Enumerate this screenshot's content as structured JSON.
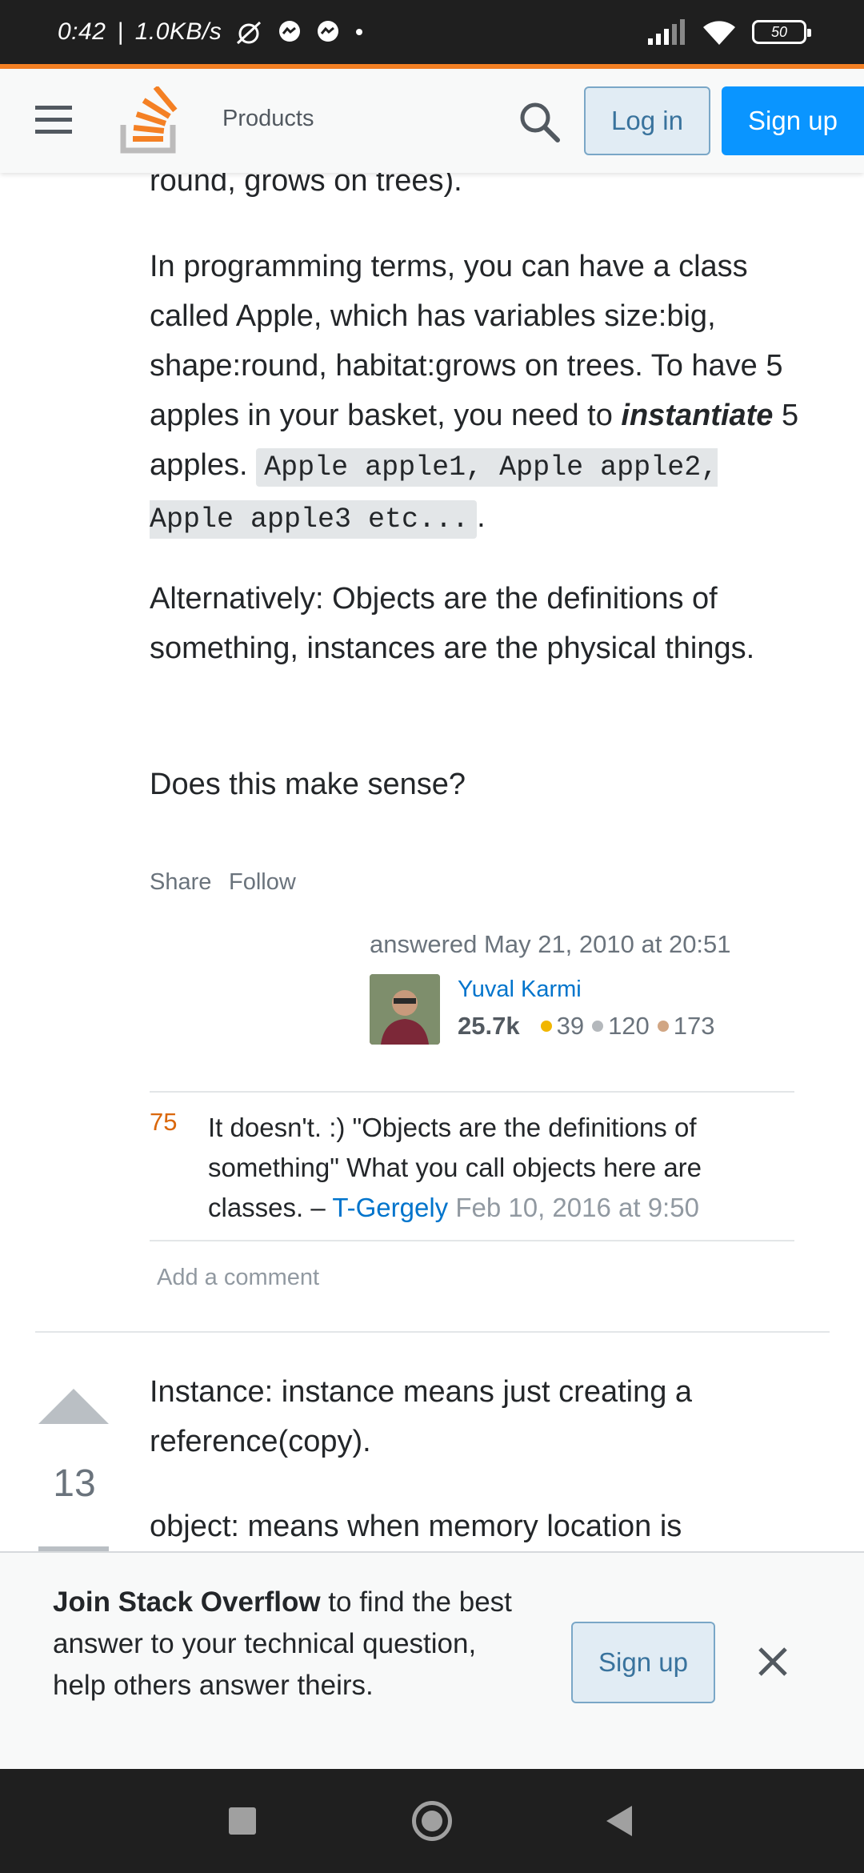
{
  "status_bar": {
    "time": "0:42",
    "separator": "|",
    "network_speed": "1.0KB/s",
    "battery": "50"
  },
  "header": {
    "products_label": "Products",
    "login_label": "Log in",
    "signup_label": "Sign up"
  },
  "answer": {
    "p0_tail": "round, grows on trees).",
    "p1_text": "In programming terms, you can have a class called Apple, which has variables size:big, shape:round, habitat:grows on trees. To have 5 apples in your basket, you need to",
    "p1_emphasis": "instantiate",
    "p1_after": "5 apples.",
    "p1_code": "Apple apple1, Apple apple2, Apple apple3 etc...",
    "p1_end": ".",
    "p2": "Alternatively: Objects are the definitions of something, instances are the physical things.",
    "p3": "Does this make sense?",
    "share_label": "Share",
    "follow_label": "Follow",
    "answered_text": "answered May 21, 2010 at 20:51",
    "user": {
      "name": "Yuval Karmi",
      "reputation": "25.7k",
      "gold": "39",
      "silver": "120",
      "bronze": "173",
      "gold_color": "#f1b600",
      "silver_color": "#b4b8bc",
      "bronze_color": "#d1a684"
    }
  },
  "comment": {
    "score": "75",
    "text": "It doesn't. :) \"Objects are the definitions of something\" What you call objects here are classes. –",
    "user": "T-Gergely",
    "date": "Feb 10, 2016 at 9:50",
    "add_comment_label": "Add a comment"
  },
  "next_answer": {
    "vote_count": "13",
    "p1": "Instance: instance means just creating a reference(copy).",
    "p2": "object: means when memory location is"
  },
  "banner": {
    "strong": "Join Stack Overflow",
    "text": " to find the best answer to your technical question, help others answer theirs.",
    "signup_label": "Sign up"
  },
  "icons": {
    "menu": "hamburger-icon",
    "logo": "stackoverflow-logo",
    "search": "search-icon",
    "close": "close-icon",
    "vote_up": "arrow-up-icon",
    "vote_down": "arrow-down-icon"
  },
  "colors": {
    "accent_orange": "#f48024",
    "brand_blue": "#0a95ff",
    "link_blue": "#0074cc"
  }
}
